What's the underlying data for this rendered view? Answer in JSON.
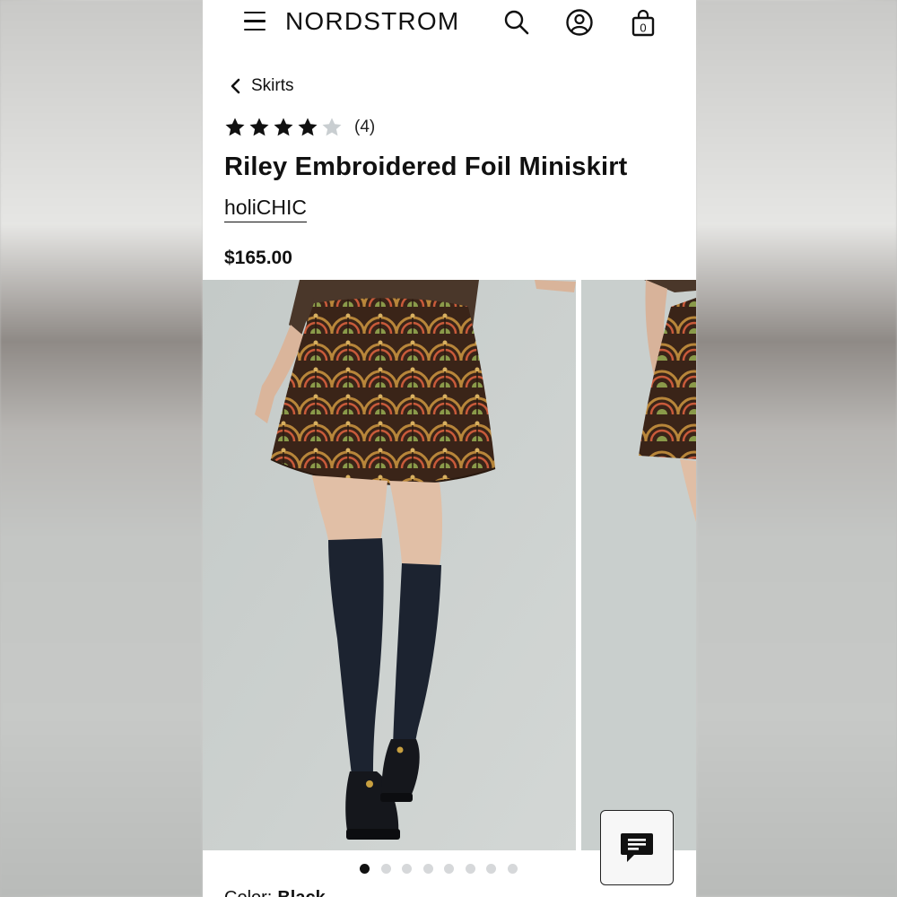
{
  "header": {
    "brand": "NORDSTROM",
    "icons": [
      "menu-icon",
      "search-icon",
      "account-icon",
      "shopping-bag-icon"
    ],
    "bag_count": "0"
  },
  "breadcrumb": {
    "label": "Skirts"
  },
  "product": {
    "rating": 4,
    "rating_max": 5,
    "review_count": "(4)",
    "title": "Riley Embroidered Foil Miniskirt",
    "brand": "holiCHIC",
    "price": "$165.00",
    "color_label": "Color:",
    "color_value": "Black"
  },
  "gallery": {
    "image_count": 8,
    "active_index": 0
  },
  "colors": {
    "text": "#111111",
    "star_filled": "#111111",
    "star_empty": "#c9ced1",
    "dot_active": "#111111",
    "dot_inactive": "#d6d8da"
  }
}
